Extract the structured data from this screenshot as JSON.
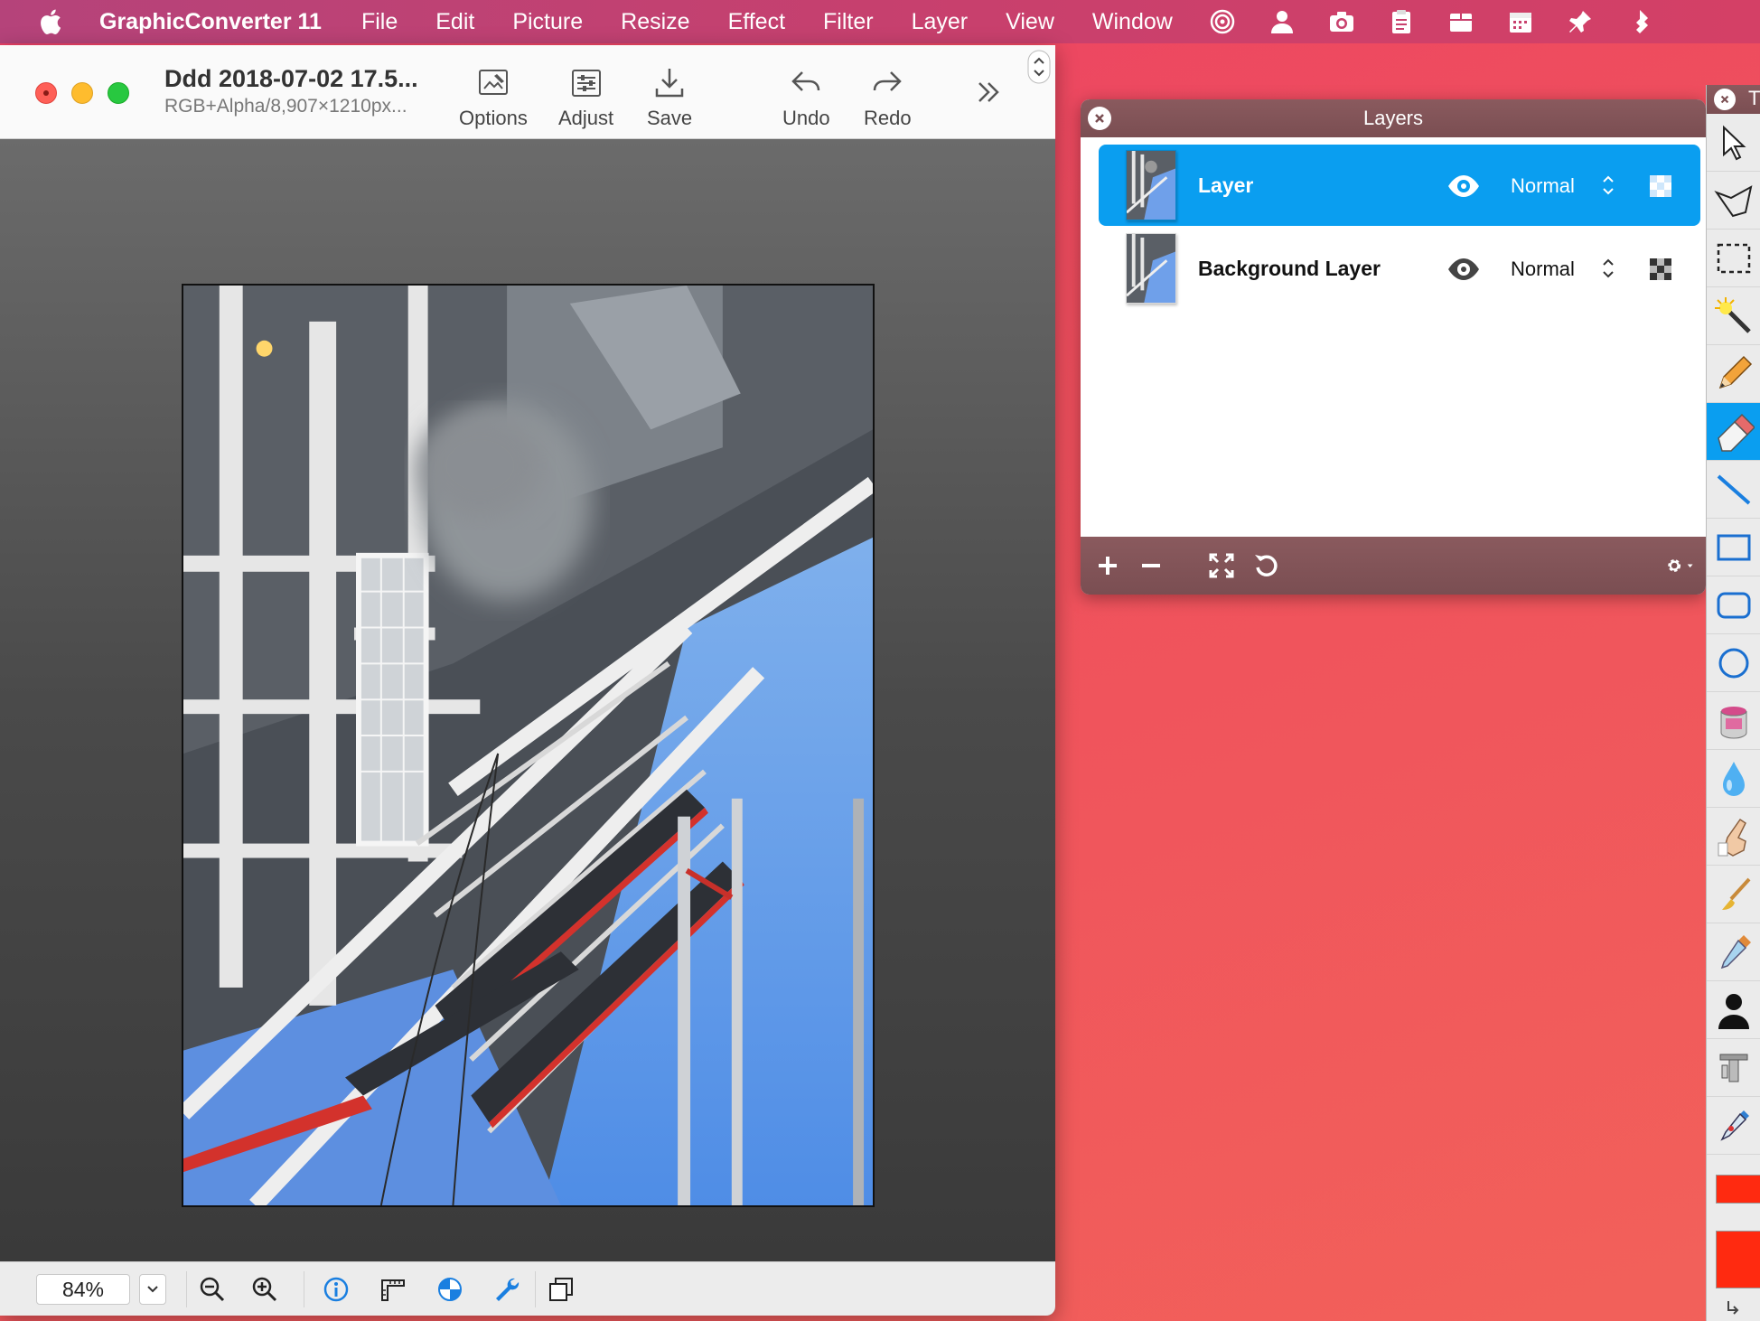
{
  "menubar": {
    "app_name": "GraphicConverter 11",
    "items": [
      "File",
      "Edit",
      "Picture",
      "Resize",
      "Effect",
      "Filter",
      "Layer",
      "View",
      "Window"
    ],
    "status_icons": [
      "target-icon",
      "person-icon",
      "camera-icon",
      "clipboard-icon",
      "package-icon",
      "calendar-icon",
      "pin-icon",
      "puzzle-icon"
    ]
  },
  "document": {
    "title": "Ddd 2018-07-02 17.5...",
    "subtitle": "RGB+Alpha/8,907×1210px...",
    "toolbar": {
      "options_label": "Options",
      "adjust_label": "Adjust",
      "save_label": "Save",
      "undo_label": "Undo",
      "redo_label": "Redo"
    },
    "zoom": "84%"
  },
  "layers_panel": {
    "title": "Layers",
    "layers": [
      {
        "name": "Layer",
        "mode": "Normal",
        "visible": true,
        "selected": true
      },
      {
        "name": "Background Layer",
        "mode": "Normal",
        "visible": true,
        "selected": false
      }
    ]
  },
  "tools_panel": {
    "title_fragment": "T",
    "tools": [
      "arrow-tool-icon",
      "lasso-tool-icon",
      "marquee-tool-icon",
      "magic-wand-icon",
      "pencil-icon",
      "eraser-icon",
      "line-tool-icon",
      "rectangle-tool-icon",
      "rounded-rect-tool-icon",
      "ellipse-tool-icon",
      "paint-bucket-icon",
      "water-drop-icon",
      "finger-smudge-icon",
      "brush-icon",
      "eyedropper-icon",
      "silhouette-icon",
      "stamp-icon",
      "syringe-icon"
    ],
    "active_tool": "eraser-icon",
    "foreground_color": "#ff2a10",
    "background_color": "#ff2a10"
  },
  "colors": {
    "accent": "#0a9ef0",
    "panel_bar": "#7a4e52"
  }
}
